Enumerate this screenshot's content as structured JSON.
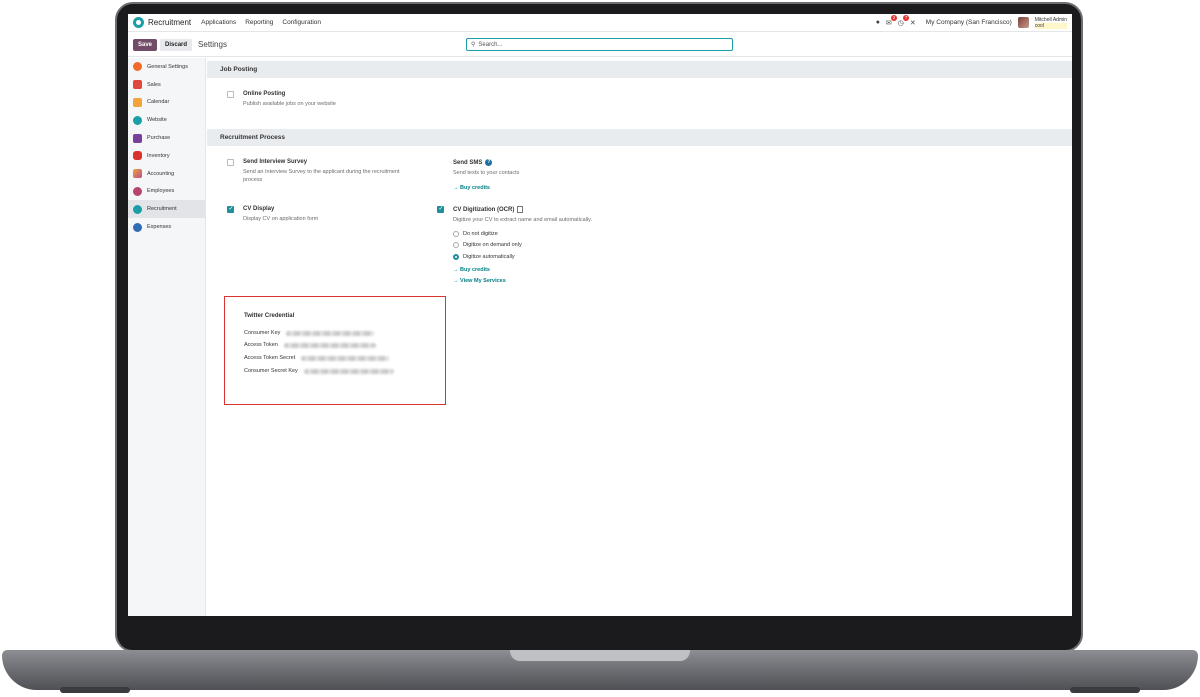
{
  "navbar": {
    "app_name": "Recruitment",
    "menu": [
      "Applications",
      "Reporting",
      "Configuration"
    ],
    "chat_badge": "2",
    "activity_badge": "7",
    "company": "My Company (San Francisco)",
    "user_name": "Mitchell Admin",
    "db_name": "cool"
  },
  "control": {
    "save_label": "Save",
    "discard_label": "Discard",
    "breadcrumb": "Settings",
    "search_placeholder": "Search..."
  },
  "sidebar": {
    "items": [
      {
        "label": "General Settings",
        "icon": "general-settings-icon",
        "color": "#f06a2a"
      },
      {
        "label": "Sales",
        "icon": "sales-icon",
        "color": "#e0483d"
      },
      {
        "label": "Calendar",
        "icon": "calendar-icon",
        "color": "#f2a33a"
      },
      {
        "label": "Website",
        "icon": "website-icon",
        "color": "#1a9fa6"
      },
      {
        "label": "Purchase",
        "icon": "purchase-icon",
        "color": "#7a3f9a"
      },
      {
        "label": "Inventory",
        "icon": "inventory-icon",
        "color": "#d9322f"
      },
      {
        "label": "Accounting",
        "icon": "accounting-icon",
        "color": "#e8a63a"
      },
      {
        "label": "Employees",
        "icon": "employees-icon",
        "color": "#b7456f"
      },
      {
        "label": "Recruitment",
        "icon": "recruitment-icon",
        "color": "#1a9fa6"
      },
      {
        "label": "Expenses",
        "icon": "expenses-icon",
        "color": "#2f6db4"
      }
    ],
    "active_index": 8
  },
  "job_posting": {
    "title": "Job Posting",
    "online_posting": {
      "label": "Online Posting",
      "desc": "Publish available jobs on your website",
      "checked": false
    }
  },
  "recruitment_process": {
    "title": "Recruitment Process",
    "interview_survey": {
      "label": "Send Interview Survey",
      "desc": "Send an Interview Survey to the applicant during the recruitment process",
      "checked": false
    },
    "send_sms": {
      "label": "Send SMS",
      "desc": "Send texts to your contacts",
      "buy_credits": "Buy credits"
    },
    "cv_display": {
      "label": "CV Display",
      "desc": "Display CV on application form",
      "checked": true
    },
    "cv_digitization": {
      "label": "CV Digitization (OCR)",
      "desc": "Digitize your CV to extract name and email automatically.",
      "checked": true,
      "options": [
        "Do not digitize",
        "Digitize on demand only",
        "Digitize automatically"
      ],
      "selected": 2,
      "buy_credits": "Buy credits",
      "view_services": "View My Services"
    }
  },
  "twitter": {
    "title": "Twitter Credential",
    "fields": [
      "Consumer Key",
      "Access Token",
      "Access Token Secret",
      "Consumer Secret Key"
    ],
    "highlight_color": "#d9322f"
  },
  "colors": {
    "brand": "#714b67",
    "accent": "#1f8f9a",
    "link": "#017e84"
  }
}
